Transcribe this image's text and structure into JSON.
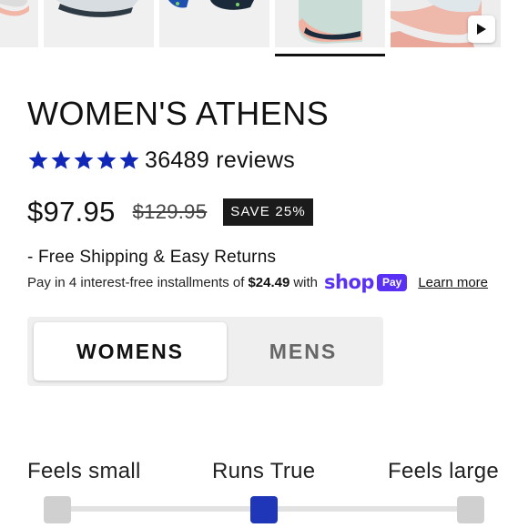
{
  "gallery": {
    "thumbnails": [
      {
        "name": "thumb-1"
      },
      {
        "name": "thumb-2"
      },
      {
        "name": "thumb-3"
      },
      {
        "name": "thumb-4-selected"
      },
      {
        "name": "thumb-5-video"
      }
    ],
    "selected_index": 3,
    "play_icon": "play-icon"
  },
  "product": {
    "title": "WOMEN'S ATHENS",
    "rating": 5,
    "review_count": "36489 reviews",
    "price": "$97.95",
    "compare_price": "$129.95",
    "save_badge": "SAVE 25%",
    "shipping": "- Free Shipping & Easy Returns"
  },
  "installments": {
    "text_before": "Pay in 4 interest-free installments of",
    "amount": "$24.49",
    "text_after": "with",
    "shop_logo": "shop",
    "pay_badge": "Pay",
    "learn_more": "Learn more"
  },
  "gender": {
    "options": [
      "WOMENS",
      "MENS"
    ],
    "selected": "WOMENS"
  },
  "fit": {
    "labels": [
      "Feels small",
      "Runs True",
      "Feels large"
    ],
    "selected": "Runs True",
    "selected_index": 1
  },
  "colors": {
    "star": "#1027b8",
    "fit_selected": "#1f36b8",
    "shop_pay": "#5a31f4",
    "badge_bg": "#1b1b1b"
  }
}
